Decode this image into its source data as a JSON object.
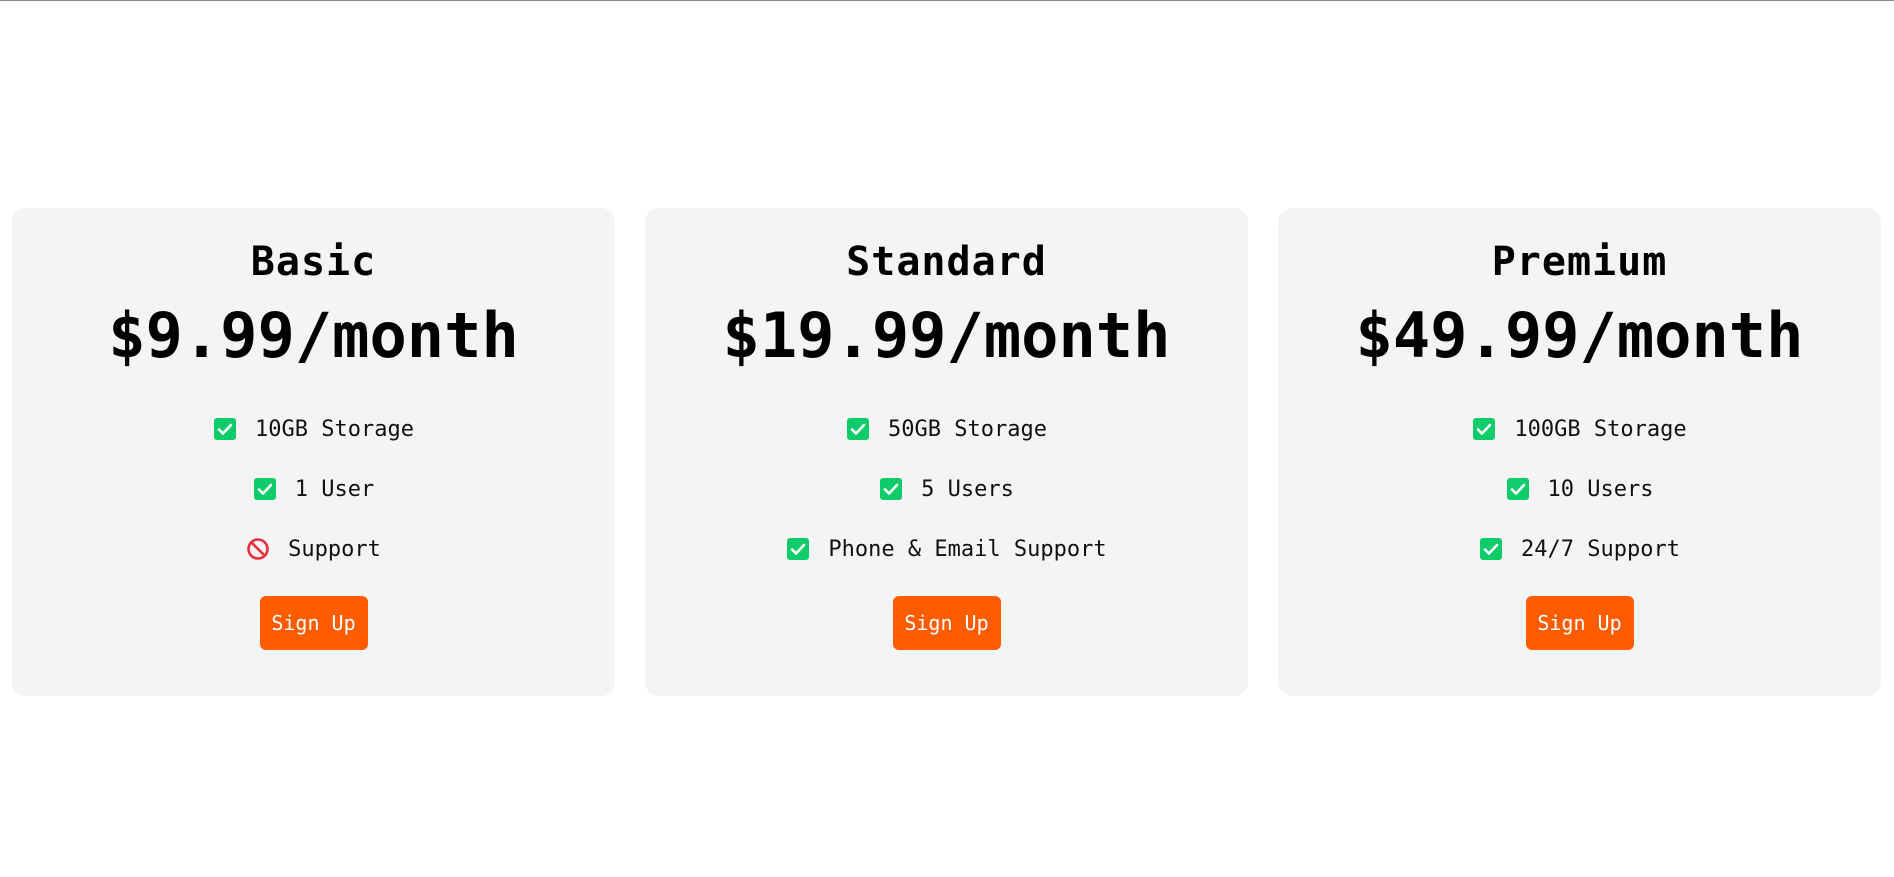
{
  "colors": {
    "card_bg": "#f4f4f4",
    "button_bg": "#ff5c00",
    "check": "#0ecc6a",
    "not_included": "#e8303c"
  },
  "plans": [
    {
      "name": "Basic",
      "price": "$9.99/month",
      "features": [
        {
          "label": "10GB Storage",
          "included": true,
          "icon": "check-icon"
        },
        {
          "label": "1 User",
          "included": true,
          "icon": "check-icon"
        },
        {
          "label": "Support",
          "included": false,
          "icon": "prohibited-icon"
        }
      ],
      "button_label": "Sign Up"
    },
    {
      "name": "Standard",
      "price": "$19.99/month",
      "features": [
        {
          "label": "50GB Storage",
          "included": true,
          "icon": "check-icon"
        },
        {
          "label": "5 Users",
          "included": true,
          "icon": "check-icon"
        },
        {
          "label": "Phone & Email Support",
          "included": true,
          "icon": "check-icon"
        }
      ],
      "button_label": "Sign Up"
    },
    {
      "name": "Premium",
      "price": "$49.99/month",
      "features": [
        {
          "label": "100GB Storage",
          "included": true,
          "icon": "check-icon"
        },
        {
          "label": "10 Users",
          "included": true,
          "icon": "check-icon"
        },
        {
          "label": "24/7 Support",
          "included": true,
          "icon": "check-icon"
        }
      ],
      "button_label": "Sign Up"
    }
  ]
}
